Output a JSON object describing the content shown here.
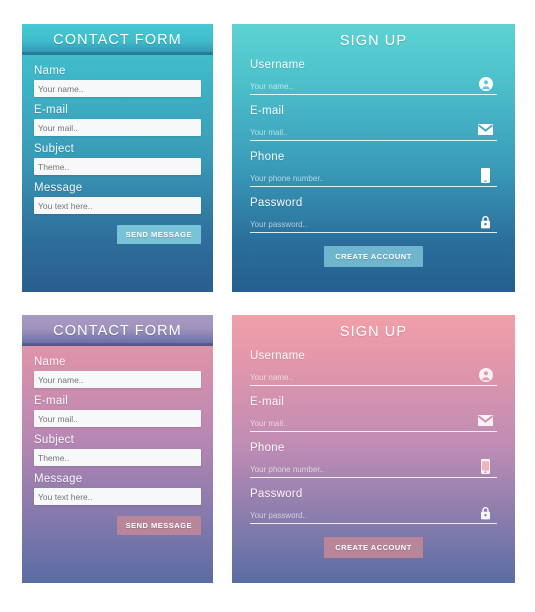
{
  "cards": {
    "contact_teal": {
      "title": "CONTACT FORM",
      "fields": [
        {
          "label": "Name",
          "placeholder": "Your name.."
        },
        {
          "label": "E-mail",
          "placeholder": "Your mail.."
        },
        {
          "label": "Subject",
          "placeholder": "Theme.."
        },
        {
          "label": "Message",
          "placeholder": "You text here.."
        }
      ],
      "submit_label": "SEND MESSAGE",
      "theme": {
        "top": "#3fc3cf",
        "bottom": "#2a5e8f",
        "button": "#79c3d8"
      }
    },
    "signup_teal": {
      "title": "SIGN UP",
      "fields": [
        {
          "label": "Username",
          "placeholder": "Your name..",
          "icon": "user-icon"
        },
        {
          "label": "E-mail",
          "placeholder": "Your mail..",
          "icon": "envelope-icon"
        },
        {
          "label": "Phone",
          "placeholder": "Your phone number..",
          "icon": "phone-icon"
        },
        {
          "label": "Password",
          "placeholder": "Your password..",
          "icon": "lock-icon"
        }
      ],
      "submit_label": "CREATE ACCOUNT",
      "theme": {
        "top": "#5ed2d2",
        "bottom": "#255f90",
        "button": "#6fb5cd"
      }
    },
    "contact_pink": {
      "title": "CONTACT FORM",
      "fields": [
        {
          "label": "Name",
          "placeholder": "Your name.."
        },
        {
          "label": "E-mail",
          "placeholder": "Your mail.."
        },
        {
          "label": "Subject",
          "placeholder": "Theme.."
        },
        {
          "label": "Message",
          "placeholder": "You text here.."
        }
      ],
      "submit_label": "SEND MESSAGE",
      "theme": {
        "top": "#e79aa8",
        "bottom": "#5a6ca3",
        "button": "#b98699"
      }
    },
    "signup_pink": {
      "title": "SIGN UP",
      "fields": [
        {
          "label": "Username",
          "placeholder": "Your name..",
          "icon": "user-icon"
        },
        {
          "label": "E-mail",
          "placeholder": "Your mail..",
          "icon": "envelope-icon"
        },
        {
          "label": "Phone",
          "placeholder": "Your phone number..",
          "icon": "phone-icon"
        },
        {
          "label": "Password",
          "placeholder": "Your password..",
          "icon": "lock-icon"
        }
      ],
      "submit_label": "CREATE ACCOUNT",
      "theme": {
        "top": "#f0a0a8",
        "bottom": "#5a6ca3",
        "button": "#b98699"
      }
    }
  }
}
